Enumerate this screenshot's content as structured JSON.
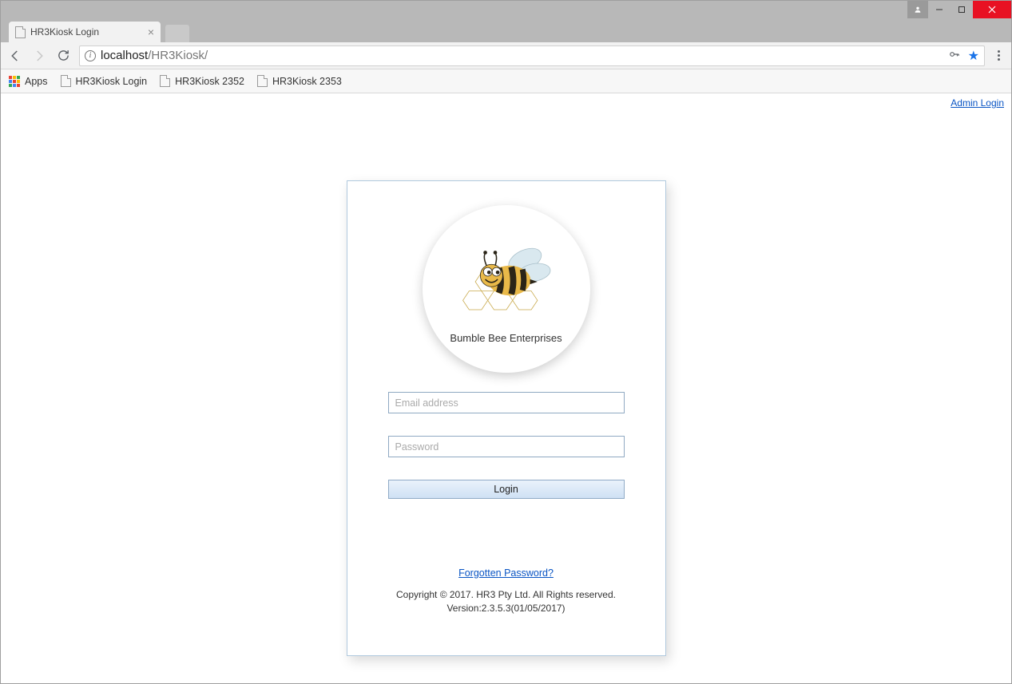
{
  "window": {
    "tab_title": "HR3Kiosk Login"
  },
  "addressbar": {
    "host": "localhost",
    "path": "/HR3Kiosk/"
  },
  "bookmarks": {
    "apps_label": "Apps",
    "items": [
      {
        "label": "HR3Kiosk Login"
      },
      {
        "label": "HR3Kiosk 2352"
      },
      {
        "label": "HR3Kiosk 2353"
      }
    ]
  },
  "page": {
    "admin_login": "Admin Login",
    "company_name": "Bumble Bee Enterprises",
    "email_placeholder": "Email address",
    "password_placeholder": "Password",
    "login_button": "Login",
    "forgot_password": "Forgotten Password?",
    "copyright_line1": "Copyright © 2017. HR3 Pty Ltd. All Rights reserved.",
    "copyright_line2": "Version:2.3.5.3(01/05/2017)"
  }
}
